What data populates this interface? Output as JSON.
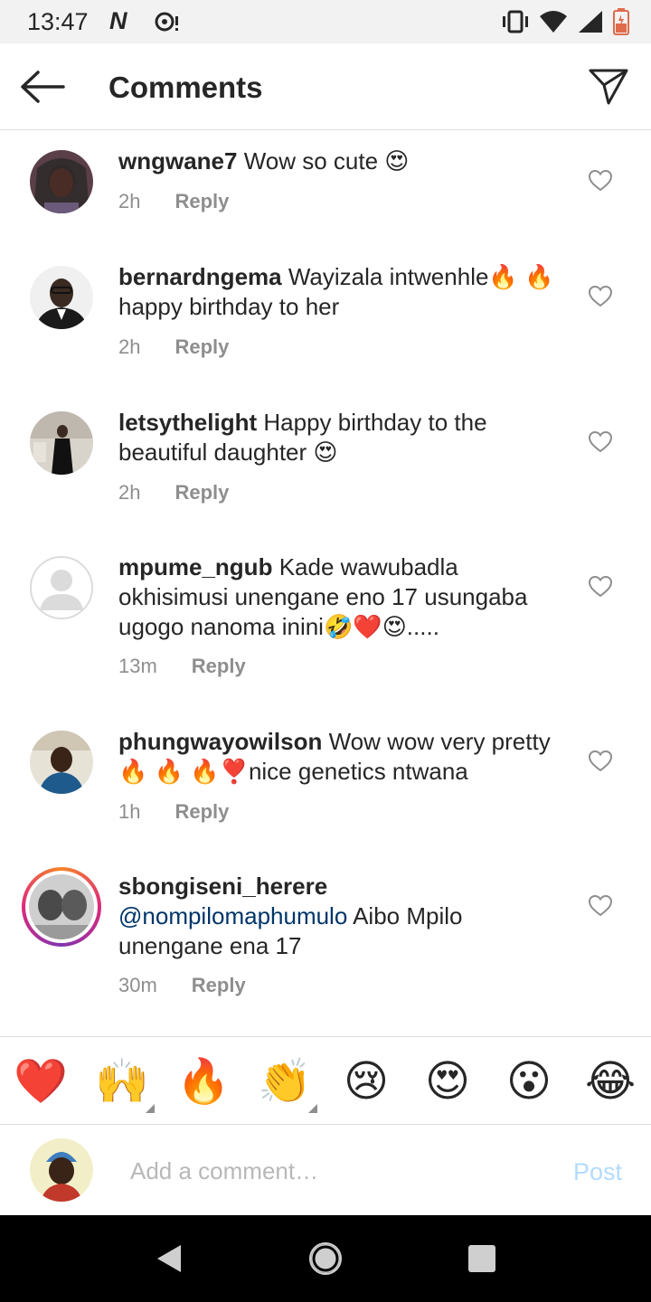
{
  "status_bar": {
    "time": "13:47",
    "notification_icon": "N"
  },
  "header": {
    "title": "Comments"
  },
  "comments": [
    {
      "username": "wngwane7",
      "text": "Wow so cute 😍",
      "time": "2h",
      "reply_label": "Reply"
    },
    {
      "username": "bernardngema",
      "text": "Wayizala intwenhle🔥 🔥 happy birthday to her",
      "time": "2h",
      "reply_label": "Reply"
    },
    {
      "username": "letsythelight",
      "text": "Happy birthday to the beautiful daughter 😍",
      "time": "2h",
      "reply_label": "Reply"
    },
    {
      "username": "mpume_ngub",
      "text": "Kade wawubadla okhisimusi unengane eno 17 usungaba ugogo nanoma inini🤣❤️😍.....",
      "time": "13m",
      "reply_label": "Reply"
    },
    {
      "username": "phungwayowilson",
      "text": "Wow wow very pretty 🔥 🔥 🔥❣️nice genetics ntwana",
      "time": "1h",
      "reply_label": "Reply"
    },
    {
      "username": "sbongiseni_herere",
      "mention": "@nompilomaphumulo",
      "text": " Aibo Mpilo unengane ena 17",
      "time": "30m",
      "reply_label": "Reply"
    }
  ],
  "quick_reactions": [
    "❤️",
    "🙌",
    "🔥",
    "👏",
    "😢",
    "😍",
    "😮",
    "😂"
  ],
  "composer": {
    "placeholder": "Add a comment…",
    "post_label": "Post"
  },
  "colors": {
    "mention": "#003569",
    "post_disabled": "#b3dbff",
    "meta": "#8e8e8e",
    "status_bar_bg": "#f2f2f2"
  }
}
